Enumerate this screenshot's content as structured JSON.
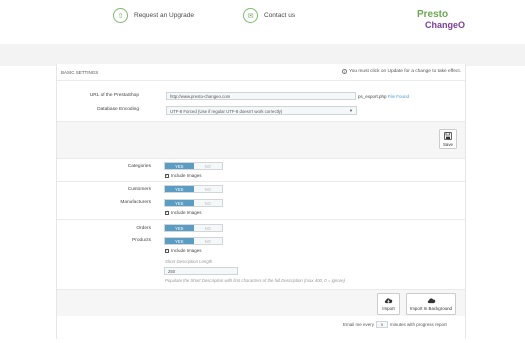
{
  "topbar": {
    "upgrade_label": "Request an Upgrade",
    "contact_label": "Contact us",
    "logo_line1": "Presto",
    "logo_line2": "ChangeO"
  },
  "panel": {
    "heading": "BASIC SETTINGS",
    "update_note": "You must click on Update for a change to take effect."
  },
  "settings": {
    "url_label": "URL of the PrestaShop",
    "url_value": "http://www.presto-changeo.com",
    "url_suffix": "ps_export.php",
    "url_suffix_link": "File Found",
    "encoding_label": "Database Encoding",
    "encoding_value": "UTF-8 Forced (Use if regular UTF-8 doesn't work correctly)"
  },
  "save_label": "Save",
  "toggle": {
    "yes": "YES",
    "no": "NO"
  },
  "sections": {
    "categories": "Categories",
    "customers": "Customers",
    "manufacturers": "Manufacturers",
    "orders": "Orders",
    "products": "Products"
  },
  "include_images": "Include Images",
  "short_desc": {
    "label": "Short Description Length",
    "value": "250",
    "hint": "Populate the Short Description with first characters of the full Description (max 400, 0 = ignore)"
  },
  "actions": {
    "import": "Import",
    "import_bg": "Import In Background"
  },
  "email": {
    "prefix": "Email me every",
    "value": "5",
    "suffix": "minutes with progress report"
  }
}
